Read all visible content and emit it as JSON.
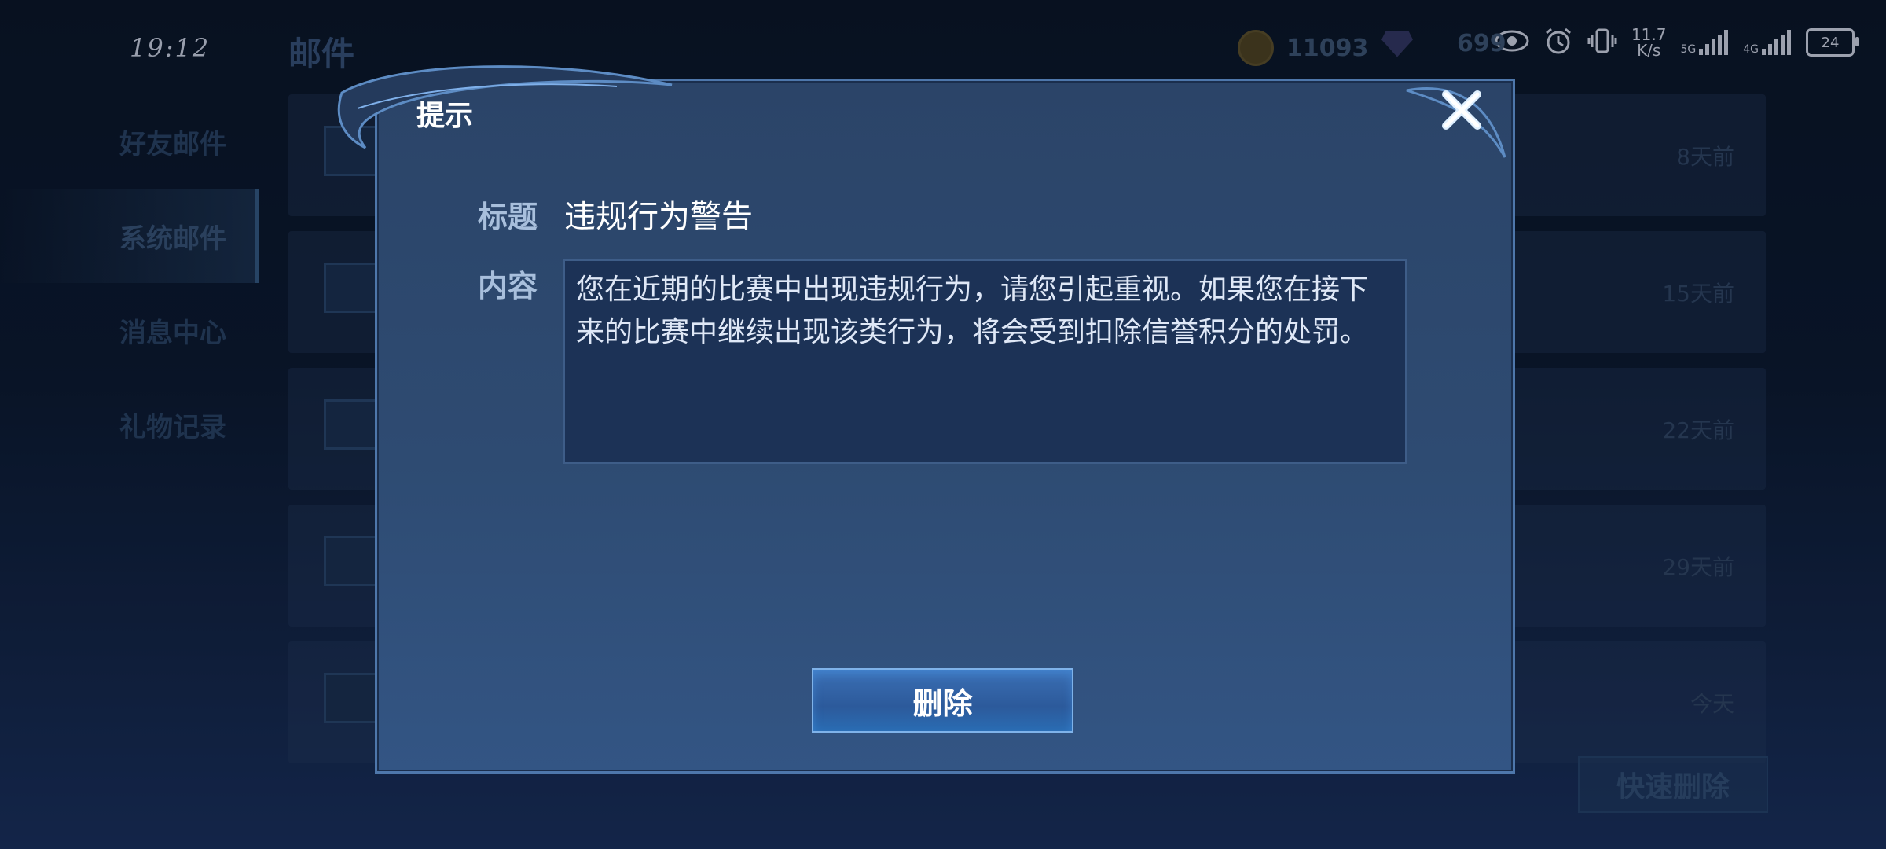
{
  "status_bar": {
    "time": "19:12",
    "net_speed": "11.7",
    "net_speed_unit": "K/s",
    "net_5g": "5G",
    "net_4g": "4G",
    "battery": "24"
  },
  "background": {
    "page_title": "邮件",
    "coins": "11093",
    "gems": "699",
    "sidebar": [
      {
        "label": "好友邮件"
      },
      {
        "label": "系统邮件"
      },
      {
        "label": "消息中心"
      },
      {
        "label": "礼物记录"
      }
    ],
    "mails": [
      {
        "time": "8天前"
      },
      {
        "time": "15天前"
      },
      {
        "time": "22天前"
      },
      {
        "time": "29天前"
      },
      {
        "time": "今天"
      }
    ],
    "quick_delete": "快速删除"
  },
  "modal": {
    "title": "提示",
    "subject_label": "标题",
    "subject": "违规行为警告",
    "content_label": "内容",
    "content": "您在近期的比赛中出现违规行为，请您引起重视。如果您在接下来的比赛中继续出现该类行为，将会受到扣除信誉积分的处罚。",
    "delete_button": "删除"
  }
}
